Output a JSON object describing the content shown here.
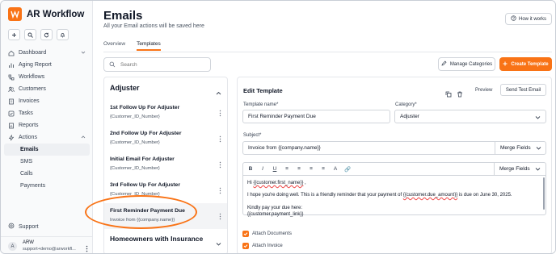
{
  "app": {
    "name": "AR Workflow"
  },
  "sidebar": {
    "items": [
      {
        "label": "Dashboard"
      },
      {
        "label": "Aging Report"
      },
      {
        "label": "Workflows"
      },
      {
        "label": "Customers"
      },
      {
        "label": "Invoices"
      },
      {
        "label": "Tasks"
      },
      {
        "label": "Reports"
      },
      {
        "label": "Actions"
      }
    ],
    "subitems": [
      {
        "label": "Emails"
      },
      {
        "label": "SMS"
      },
      {
        "label": "Calls"
      },
      {
        "label": "Payments"
      }
    ],
    "support": "Support",
    "user": {
      "initial": "A",
      "name": "ARW",
      "email": "support+demo@arworkfl..."
    }
  },
  "header": {
    "title": "Emails",
    "subtitle": "All your Email actions will be saved here",
    "how_it_works": "How it works"
  },
  "tabs": [
    {
      "label": "Overview"
    },
    {
      "label": "Templates"
    }
  ],
  "search": {
    "placeholder": "Search"
  },
  "actions": {
    "manage_categories": "Manage Categories",
    "create_template": "Create Template"
  },
  "templates": {
    "group1": "Adjuster",
    "items": [
      {
        "name": "1st Follow Up For Adjuster",
        "code": "{Customer_ID_Number}"
      },
      {
        "name": "2nd Follow Up For Adjuster",
        "code": "{Customer_ID_Number}"
      },
      {
        "name": "Initial Email For Adjuster",
        "code": "{Customer_ID_Number}"
      },
      {
        "name": "3rd Follow Up For Adjuster",
        "code": "{Customer_ID_Number}"
      },
      {
        "name": "First Reminder Payment Due",
        "code": "Invoice from {{company.name}}"
      }
    ],
    "group2": "Homeowners with Insurance"
  },
  "editor": {
    "title": "Edit Template",
    "preview": "Preview",
    "send_test": "Send Test Email",
    "template_name_label": "Template name*",
    "template_name_value": "First Reminder Payment Due",
    "category_label": "Category*",
    "category_value": "Adjuster",
    "subject_label": "Subject*",
    "subject_value": "Invoice from {{company.name}}",
    "merge_fields": "Merge Fields",
    "toolbar": [
      "B",
      "I",
      "U",
      "≡",
      "≡",
      "≡",
      "≡",
      "A",
      "🔗"
    ],
    "body": {
      "greeting_prefix": "Hi ",
      "greeting_field": "{{customer.first_name}}",
      "greeting_suffix": " ,",
      "line2_a": "I hope you're doing well. This is a friendly reminder that your payment of ",
      "line2_field": "{{customer.due_amount}}",
      "line2_b": "  is due on June 30, 2025.",
      "line3": "Kindly pay your due here:",
      "line4": "{{customer.payment_link}}"
    },
    "attach_documents": "Attach Documents",
    "attach_invoice": "Attach Invoice"
  }
}
